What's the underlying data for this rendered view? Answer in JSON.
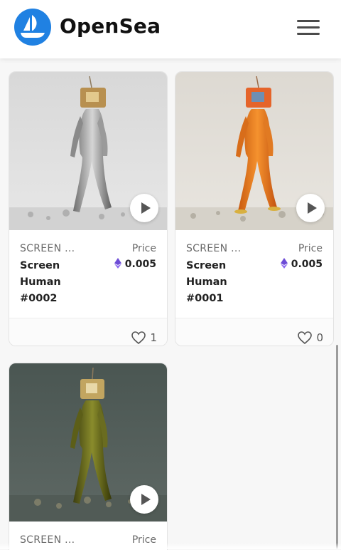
{
  "header": {
    "brand": "OpenSea",
    "logo_icon": "opensea-boat-logo",
    "menu_icon": "hamburger-menu-icon"
  },
  "colors": {
    "brand_blue": "#2081e2",
    "eth_purple": "#6d4cd6"
  },
  "cards": [
    {
      "collection": "SCREEN ...",
      "name": "Screen Human #0002",
      "price_label": "Price",
      "price": "0.005",
      "likes": "1",
      "image_style": "silver-figure"
    },
    {
      "collection": "SCREEN ...",
      "name": "Screen Human #0001",
      "price_label": "Price",
      "price": "0.005",
      "likes": "0",
      "image_style": "orange-figure"
    },
    {
      "collection": "SCREEN ...",
      "price_label": "Price",
      "image_style": "olive-figure"
    }
  ]
}
